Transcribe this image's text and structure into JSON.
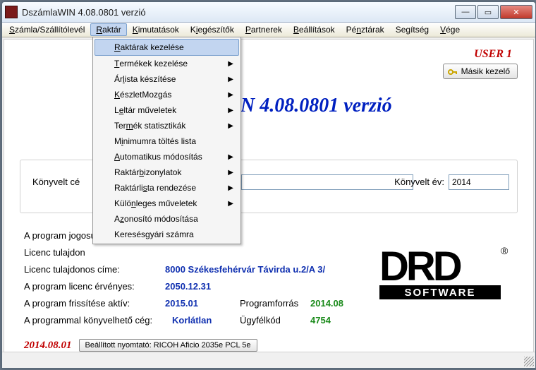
{
  "window": {
    "title": "DszámlaWIN 4.08.0801 verzió"
  },
  "menubar": {
    "items": [
      {
        "pre": "",
        "u": "S",
        "post": "zámla/Szállítólevél"
      },
      {
        "pre": "",
        "u": "R",
        "post": "aktár",
        "active": true
      },
      {
        "pre": "",
        "u": "K",
        "post": "imutatások"
      },
      {
        "pre": "K",
        "u": "i",
        "post": "egészítők"
      },
      {
        "pre": "",
        "u": "P",
        "post": "artnerek"
      },
      {
        "pre": "",
        "u": "B",
        "post": "eállítások"
      },
      {
        "pre": "Pé",
        "u": "n",
        "post": "ztárak"
      },
      {
        "pre": "Se",
        "u": "g",
        "post": "ítség"
      },
      {
        "pre": "",
        "u": "V",
        "post": "ége"
      }
    ]
  },
  "dropdown": {
    "items": [
      {
        "pre": "",
        "u": "R",
        "post": "aktárak kezelése",
        "sub": false,
        "hi": true
      },
      {
        "pre": "",
        "u": "T",
        "post": "ermékek kezelése",
        "sub": true
      },
      {
        "pre": "Ár",
        "u": "l",
        "post": "ista készítése",
        "sub": true
      },
      {
        "pre": "",
        "u": "K",
        "post": "észletMozgás",
        "sub": true
      },
      {
        "pre": "L",
        "u": "e",
        "post": "ltár műveletek",
        "sub": true
      },
      {
        "pre": "Ter",
        "u": "m",
        "post": "ék statisztikák",
        "sub": true
      },
      {
        "pre": "M",
        "u": "i",
        "post": "nimumra töltés lista",
        "sub": false
      },
      {
        "pre": "",
        "u": "A",
        "post": "utomatikus módosítás",
        "sub": true
      },
      {
        "pre": "Raktár ",
        "u": "b",
        "post": "izonylatok",
        "sub": true
      },
      {
        "pre": "Raktárli",
        "u": "s",
        "post": "ta rendezése",
        "sub": true
      },
      {
        "pre": "Külö",
        "u": "n",
        "post": "leges műveletek",
        "sub": true
      },
      {
        "pre": "A",
        "u": "z",
        "post": "onosító módosítása",
        "sub": false
      },
      {
        "pre": "Keresés ",
        "u": "g",
        "post": "yári számra",
        "sub": false
      }
    ]
  },
  "user_label": "USER 1",
  "other_button": "Másik kezelő",
  "big_title_fragment": "N 4.08.0801 verzió",
  "form": {
    "label1": "Könyvelt cé",
    "value1": "",
    "label2": "Könyvelt év:",
    "value2": "2014"
  },
  "licence": {
    "row0": "A program jogosul",
    "row1_lab": "Licenc tulajdon",
    "row2_lab": "Licenc tulajdonos címe:",
    "row2_val": "8000 Székesfehérvár Távirda u.2/A 3/",
    "row3_lab": "A program licenc érvényes:",
    "row3_val": "2050.12.31",
    "row4_lab": "A program frissítése aktív:",
    "row4_val": "2015.01",
    "row4_lab2": "Programforrás",
    "row4_val2": "2014.08",
    "row5_lab": "A programmal könyvelhető cég:",
    "row5_val": "Korlátlan",
    "row5_lab2": "Ügyfélkód",
    "row5_val2": "4754"
  },
  "bottom": {
    "date": "2014.08.01",
    "printer": "Beállított nyomtató: RICOH Aficio 2035e PCL 5e"
  },
  "logo_text_top": "DRD",
  "logo_text_bot": "software"
}
